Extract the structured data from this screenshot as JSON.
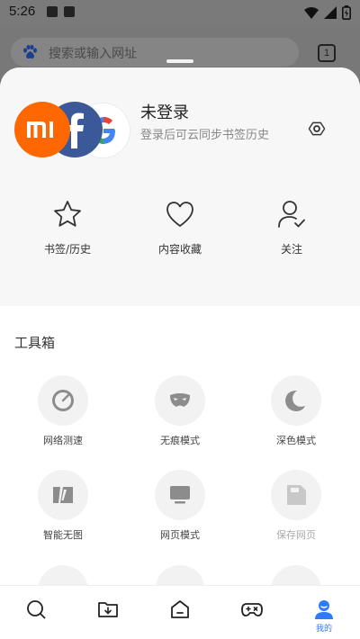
{
  "status_bar": {
    "time": "5:26"
  },
  "background_browser": {
    "search_placeholder": "搜索或输入网址",
    "tab_count": "1"
  },
  "account": {
    "title": "未登录",
    "subtitle": "登录后可云同步书签历史"
  },
  "quick_actions": [
    {
      "label": "书签/历史",
      "icon": "star-icon"
    },
    {
      "label": "内容收藏",
      "icon": "heart-icon"
    },
    {
      "label": "关注",
      "icon": "follow-user-icon"
    }
  ],
  "toolbox": {
    "title": "工具箱",
    "items": [
      {
        "label": "网络测速",
        "icon": "speedometer-icon"
      },
      {
        "label": "无痕模式",
        "icon": "mask-icon"
      },
      {
        "label": "深色模式",
        "icon": "moon-icon"
      },
      {
        "label": "智能无图",
        "icon": "no-image-icon"
      },
      {
        "label": "网页模式",
        "icon": "desktop-icon"
      },
      {
        "label": "保存网页",
        "icon": "save-page-icon",
        "disabled": true
      }
    ]
  },
  "bottom_nav": {
    "items": [
      {
        "name": "search",
        "icon": "search-icon"
      },
      {
        "name": "downloads",
        "icon": "download-folder-icon"
      },
      {
        "name": "home",
        "icon": "home-icon"
      },
      {
        "name": "games",
        "icon": "gamepad-icon"
      },
      {
        "name": "me",
        "icon": "user-icon",
        "label": "我的",
        "active": true
      }
    ]
  },
  "colors": {
    "accent": "#2f7bf5",
    "mi_orange": "#ff6700",
    "facebook_blue": "#3b5998"
  }
}
